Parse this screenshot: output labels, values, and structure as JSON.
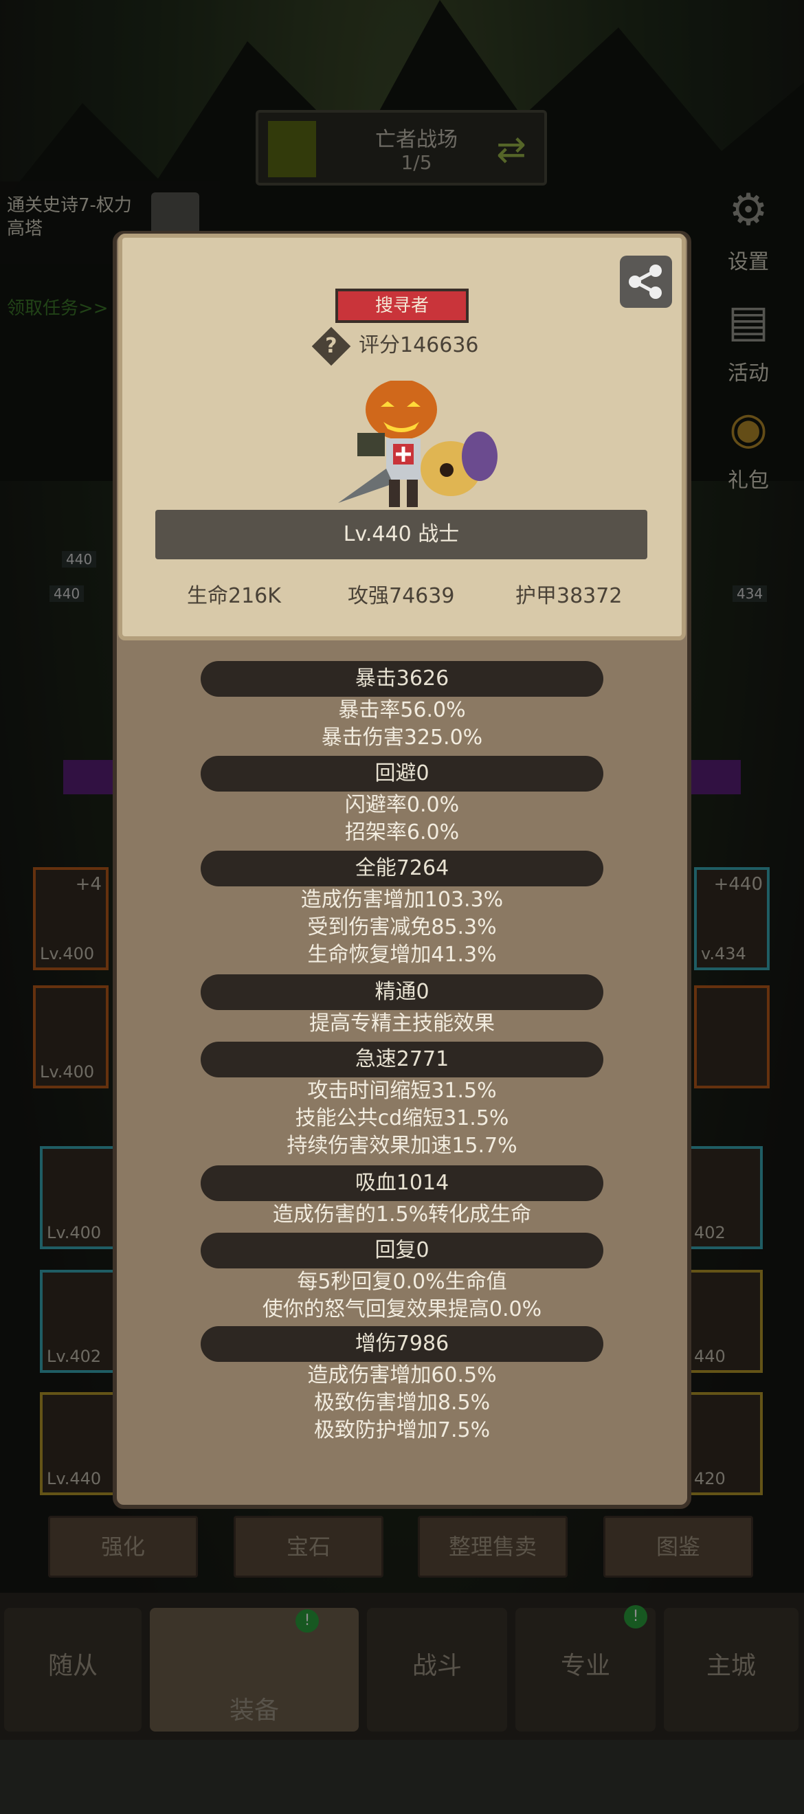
{
  "stage": {
    "title": "亡者战场",
    "progress": "1/5"
  },
  "quest": {
    "text": "通关史诗7-权力高塔",
    "link": "领取任务>>"
  },
  "side_buttons": [
    {
      "label": "设置",
      "icon": "gear-icon"
    },
    {
      "label": "活动",
      "icon": "scroll-icon"
    },
    {
      "label": "礼包",
      "icon": "gift-icon"
    }
  ],
  "bg_levels": {
    "a": "440",
    "b": "440",
    "c": "434"
  },
  "slots": {
    "l1_plus": "+4",
    "l1_lv": "Lv.400",
    "l2_lv": "Lv.400",
    "r1_plus": "+440",
    "r1_lv": "v.434",
    "l3_lv": "Lv.400",
    "l4_lv": "Lv.402",
    "l5_lv": "Lv.440",
    "r3_lv": "402",
    "r4_lv": "440",
    "r5_lv": "420"
  },
  "tabs": [
    "强化",
    "宝石",
    "整理售卖",
    "图鉴"
  ],
  "bottom_nav": [
    "随从",
    "装备",
    "战斗",
    "专业",
    "主城"
  ],
  "profile": {
    "role": "搜寻者",
    "score": "评分146636",
    "level": "Lv.440 战士",
    "hp": "生命216K",
    "atk": "攻强74639",
    "armor": "护甲38372"
  },
  "stats": [
    {
      "head": "暴击3626",
      "lines": [
        "暴击率56.0%",
        "暴击伤害325.0%"
      ]
    },
    {
      "head": "回避0",
      "lines": [
        "闪避率0.0%",
        "招架率6.0%"
      ]
    },
    {
      "head": "全能7264",
      "lines": [
        "造成伤害增加103.3%",
        "受到伤害减免85.3%",
        "生命恢复增加41.3%"
      ]
    },
    {
      "head": "精通0",
      "lines": [
        "提高专精主技能效果"
      ]
    },
    {
      "head": "急速2771",
      "lines": [
        "攻击时间缩短31.5%",
        "技能公共cd缩短31.5%",
        "持续伤害效果加速15.7%"
      ]
    },
    {
      "head": "吸血1014",
      "lines": [
        "造成伤害的1.5%转化成生命"
      ]
    },
    {
      "head": "回复0",
      "lines": [
        "每5秒回复0.0%生命值",
        "使你的怒气回复效果提高0.0%"
      ]
    },
    {
      "head": "增伤7986",
      "lines": [
        "造成伤害增加60.5%",
        "极致伤害增加8.5%",
        "极致防护增加7.5%"
      ]
    }
  ]
}
